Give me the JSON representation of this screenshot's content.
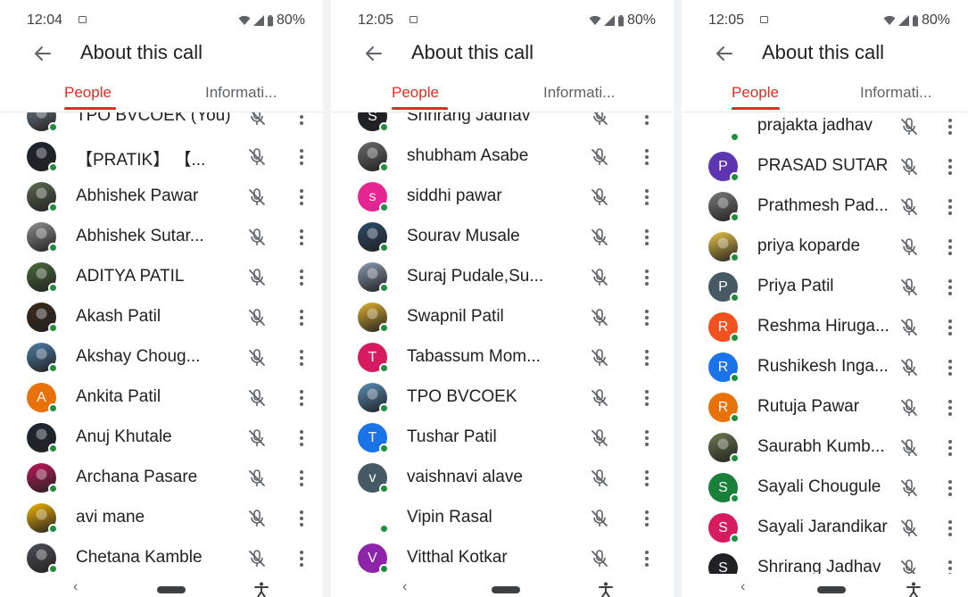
{
  "colors": {
    "accent": "#d93025",
    "online": "#1e8e3e",
    "icon": "#5f6368"
  },
  "icons": {
    "notification": "notification-icon",
    "wifi": "wifi-icon",
    "signal": "signal-icon",
    "battery": "battery-icon",
    "back": "back-arrow-icon",
    "mic_off": "mic-off-icon",
    "more": "more-vert-icon",
    "nav_back": "nav-back-icon",
    "home": "home-pill",
    "accessibility": "accessibility-icon"
  },
  "panels": [
    {
      "status": {
        "time": "12:04",
        "battery": "80%"
      },
      "title": "About this call",
      "tabs": [
        {
          "label": "People"
        },
        {
          "label": "Informati..."
        }
      ],
      "nav": {
        "back_glyph": "‹"
      },
      "rows": [
        {
          "name": "TPO BVCOEK (You)",
          "avatar": {
            "type": "photo",
            "color": "#6d7b8a"
          }
        },
        {
          "name": "【PRATIK】 【...",
          "avatar": {
            "type": "photo",
            "color": "#1b2330"
          }
        },
        {
          "name": "Abhishek Pawar",
          "avatar": {
            "type": "photo",
            "color": "#5d6a52"
          }
        },
        {
          "name": "Abhishek Sutar...",
          "avatar": {
            "type": "photo",
            "color": "#8f8f8f"
          }
        },
        {
          "name": "ADITYA PATIL",
          "avatar": {
            "type": "photo",
            "color": "#4a6b3a"
          }
        },
        {
          "name": "Akash Patil",
          "avatar": {
            "type": "photo",
            "color": "#3b2a1a"
          }
        },
        {
          "name": "Akshay Choug...",
          "avatar": {
            "type": "photo",
            "color": "#4d7fa8"
          }
        },
        {
          "name": "Ankita Patil",
          "avatar": {
            "type": "initial",
            "letter": "A",
            "color": "#e8710a"
          }
        },
        {
          "name": "Anuj Khutale",
          "avatar": {
            "type": "photo",
            "color": "#1c2633"
          }
        },
        {
          "name": "Archana Pasare",
          "avatar": {
            "type": "photo",
            "color": "#c2185b"
          }
        },
        {
          "name": "avi mane",
          "avatar": {
            "type": "photo",
            "color": "#f4b400"
          }
        },
        {
          "name": "Chetana Kamble",
          "avatar": {
            "type": "photo",
            "color": "#4e4e5a"
          }
        }
      ]
    },
    {
      "status": {
        "time": "12:05",
        "battery": "80%"
      },
      "title": "About this call",
      "tabs": [
        {
          "label": "People"
        },
        {
          "label": "Informati..."
        }
      ],
      "nav": {
        "back_glyph": "‹"
      },
      "rows": [
        {
          "name": "Shrirang Jadhav",
          "avatar": {
            "type": "initial",
            "letter": "S",
            "color": "#202124"
          }
        },
        {
          "name": "shubham Asabe",
          "avatar": {
            "type": "photo",
            "color": "#6b6b6b"
          }
        },
        {
          "name": "siddhi pawar",
          "avatar": {
            "type": "initial",
            "letter": "s",
            "color": "#e52592"
          }
        },
        {
          "name": "Sourav Musale",
          "avatar": {
            "type": "photo",
            "color": "#2b4a6b"
          }
        },
        {
          "name": "Suraj Pudale,Su...",
          "avatar": {
            "type": "photo",
            "color": "#8a9bb0"
          }
        },
        {
          "name": "Swapnil Patil",
          "avatar": {
            "type": "photo",
            "color": "#e0b030"
          }
        },
        {
          "name": "Tabassum Mom...",
          "avatar": {
            "type": "initial",
            "letter": "T",
            "color": "#d81b60"
          }
        },
        {
          "name": "TPO BVCOEK",
          "avatar": {
            "type": "photo",
            "color": "#5a8fb8"
          }
        },
        {
          "name": "Tushar Patil",
          "avatar": {
            "type": "initial",
            "letter": "T",
            "color": "#1a73e8"
          }
        },
        {
          "name": "vaishnavi alave",
          "avatar": {
            "type": "initial",
            "letter": "v",
            "color": "#455a64"
          }
        },
        {
          "name": "Vipin Rasal",
          "avatar": {
            "type": "none",
            "color": "#ffffff"
          }
        },
        {
          "name": "Vitthal Kotkar",
          "avatar": {
            "type": "initial",
            "letter": "V",
            "color": "#8e24aa"
          }
        }
      ]
    },
    {
      "status": {
        "time": "12:05",
        "battery": "80%"
      },
      "title": "About this call",
      "tabs": [
        {
          "label": "People"
        },
        {
          "label": "Informati..."
        }
      ],
      "nav": {
        "back_glyph": "‹"
      },
      "rows": [
        {
          "name": "prajakta jadhav",
          "avatar": {
            "type": "none",
            "color": "#ffffff"
          }
        },
        {
          "name": "PRASAD SUTAR",
          "avatar": {
            "type": "initial",
            "letter": "P",
            "color": "#5e35b1"
          }
        },
        {
          "name": "Prathmesh Pad...",
          "avatar": {
            "type": "photo",
            "color": "#7a7a7a"
          }
        },
        {
          "name": "priya koparde",
          "avatar": {
            "type": "photo",
            "color": "#e8c34a"
          }
        },
        {
          "name": "Priya Patil",
          "avatar": {
            "type": "initial",
            "letter": "P",
            "color": "#455a64"
          }
        },
        {
          "name": "Reshma Hiruga...",
          "avatar": {
            "type": "initial",
            "letter": "R",
            "color": "#f4511e"
          }
        },
        {
          "name": "Rushikesh Inga...",
          "avatar": {
            "type": "initial",
            "letter": "R",
            "color": "#1a73e8"
          }
        },
        {
          "name": "Rutuja Pawar",
          "avatar": {
            "type": "initial",
            "letter": "R",
            "color": "#e8710a"
          }
        },
        {
          "name": "Saurabh Kumb...",
          "avatar": {
            "type": "photo",
            "color": "#6a7a50"
          }
        },
        {
          "name": "Sayali Chougule",
          "avatar": {
            "type": "initial",
            "letter": "S",
            "color": "#188038"
          }
        },
        {
          "name": "Sayali Jarandikar",
          "avatar": {
            "type": "initial",
            "letter": "S",
            "color": "#d81b60"
          }
        },
        {
          "name": "Shrirang Jadhav",
          "avatar": {
            "type": "initial",
            "letter": "S",
            "color": "#202124"
          }
        }
      ]
    }
  ]
}
